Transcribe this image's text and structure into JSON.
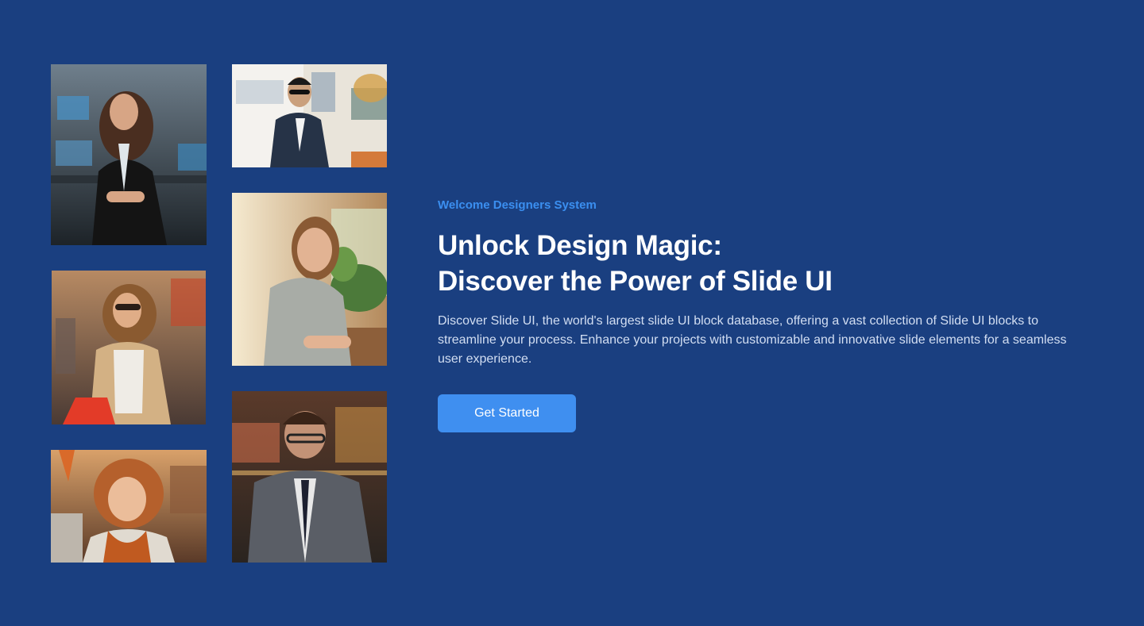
{
  "hero": {
    "eyebrow": "Welcome Designers System",
    "headline_line1": "Unlock Design Magic:",
    "headline_line2": "Discover the Power of Slide UI",
    "description": "Discover Slide UI, the world's largest slide UI block database, offering a vast collection of Slide UI blocks to streamline your process. Enhance your projects with customizable and innovative slide elements for a seamless user experience.",
    "cta_label": "Get Started"
  },
  "colors": {
    "background": "#1a3f80",
    "accent": "#3b8ff0",
    "button": "#3f8ff0",
    "heading": "#ffffff",
    "body_text": "#d2def2"
  },
  "gallery": [
    {
      "icon": "photo-businesswoman-office"
    },
    {
      "icon": "photo-man-sunglasses-suit"
    },
    {
      "icon": "photo-woman-smiling-cafe"
    },
    {
      "icon": "photo-woman-shopping-bag"
    },
    {
      "icon": "photo-man-glasses-suit"
    },
    {
      "icon": "photo-woman-curly-hair-shop"
    }
  ]
}
